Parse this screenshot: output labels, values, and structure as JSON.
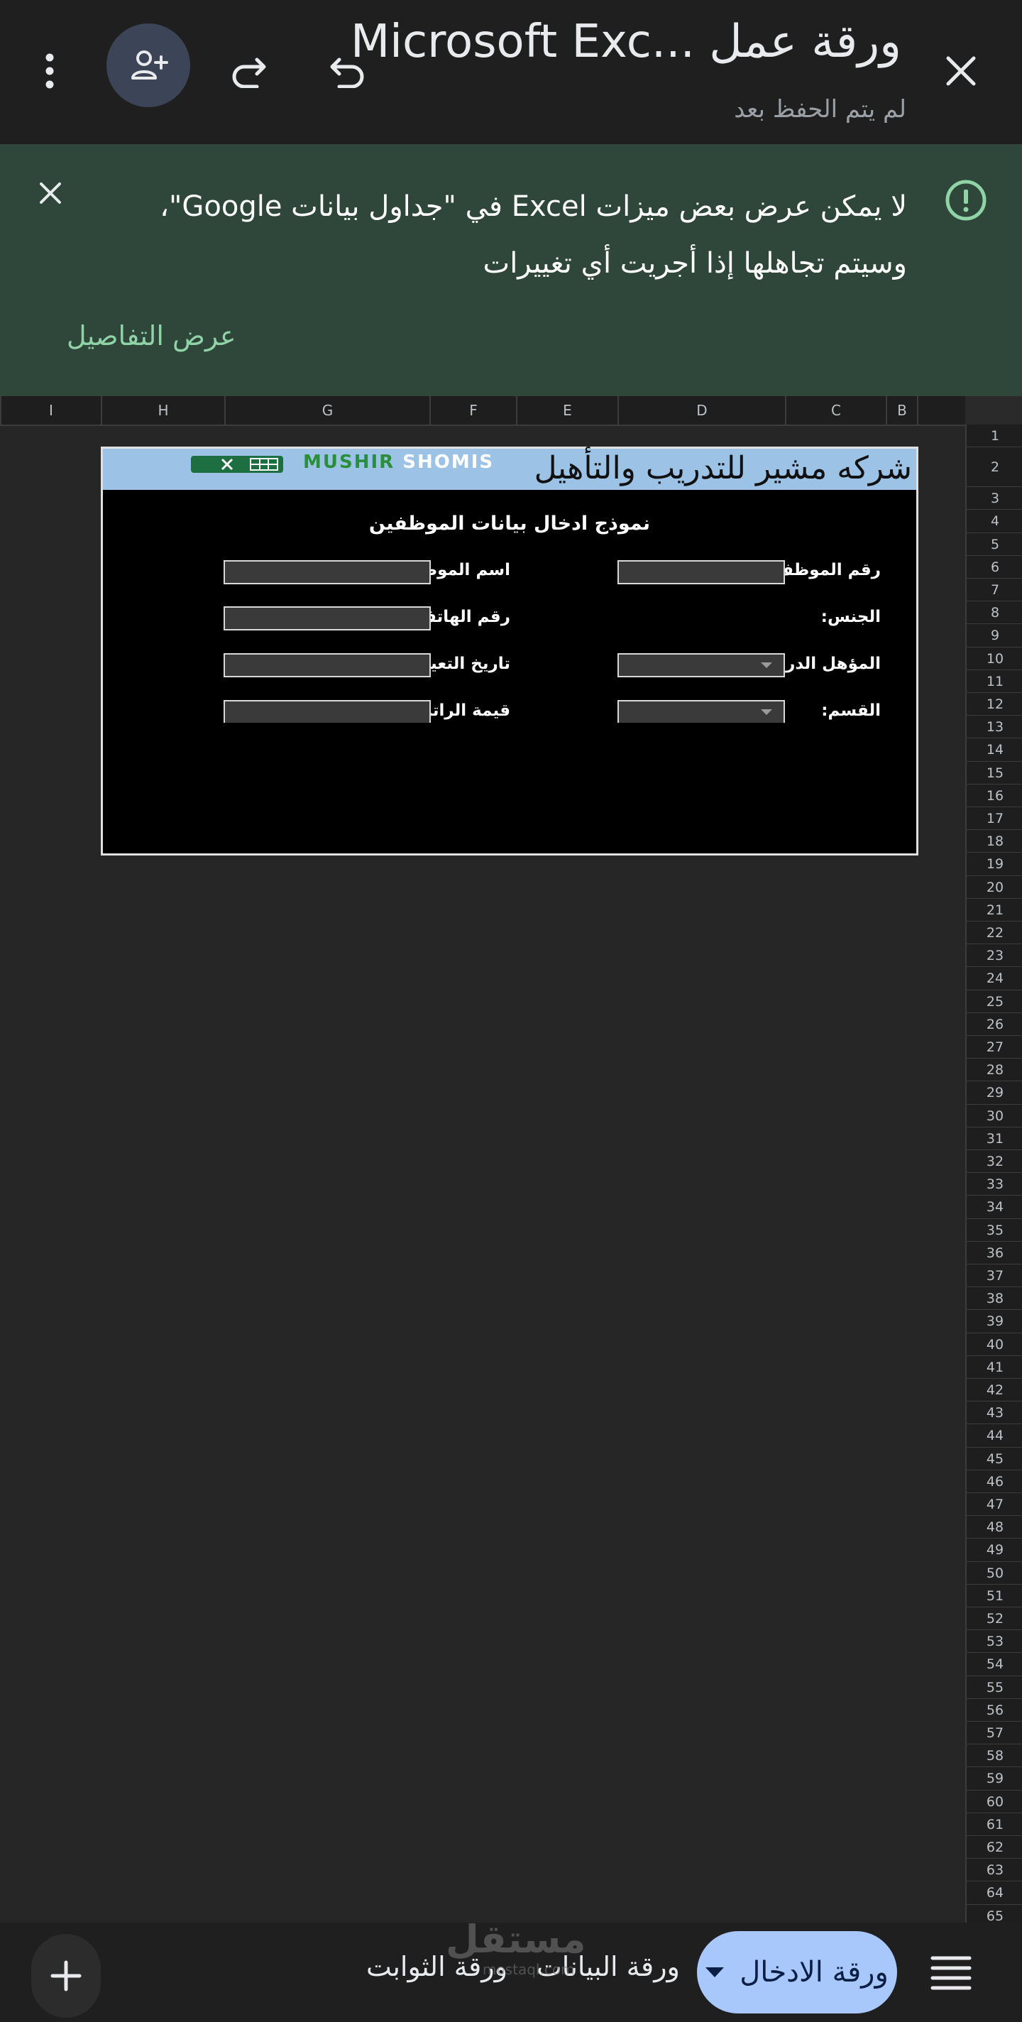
{
  "app_bar": {
    "title": "ورقة عمل ...Microsoft Exc",
    "subtitle": "لم يتم الحفظ بعد",
    "icons": [
      "close-icon",
      "undo-icon",
      "redo-icon",
      "person-add-icon",
      "more-vert-icon"
    ]
  },
  "banner": {
    "message": "لا يمكن عرض بعض ميزات Excel في \"جداول بيانات Google\"، وسيتم تجاهلها إذا أجريت أي تغييرات",
    "details_label": "عرض التفاصيل",
    "accent_color": "#8fd3a6"
  },
  "grid": {
    "columns": [
      "I",
      "H",
      "G",
      "F",
      "E",
      "D",
      "C",
      "B"
    ],
    "rows": [
      "1",
      "2",
      "3",
      "4",
      "5",
      "6",
      "7",
      "8",
      "9",
      "10",
      "11",
      "12",
      "13",
      "14",
      "15",
      "16",
      "17",
      "18",
      "19",
      "20",
      "21",
      "22",
      "23",
      "24",
      "25",
      "26",
      "27",
      "28",
      "29",
      "30",
      "31",
      "32",
      "33",
      "34",
      "35",
      "36",
      "37",
      "38",
      "39",
      "40",
      "41",
      "42",
      "43",
      "44",
      "45",
      "46",
      "47",
      "48",
      "49",
      "50",
      "51",
      "52",
      "53",
      "54",
      "55",
      "56",
      "57",
      "58",
      "59",
      "60",
      "61",
      "62",
      "63",
      "64",
      "65"
    ]
  },
  "form": {
    "company_name": "شركه مشير للتدريب والتأهيل",
    "logo_text_green": "MUSHIR",
    "logo_text_white": "SHOMIS",
    "heading": "نموذج ادخال بيانات الموظفين",
    "fields": {
      "employee_number": "رقم الموظف:",
      "employee_name": "اسم الموظف:",
      "gender": "الجنس:",
      "phone": "رقم الهاتف:",
      "qualification": "المؤهل الدراسي",
      "hire_date": "تاريخ التعيين:",
      "department": "القسم:",
      "salary": "قيمة الراتب:"
    }
  },
  "sheet_tabs": {
    "active": "ورقة الادخال",
    "others": [
      "ورقة البيانات",
      "ورقة الثوابت"
    ],
    "active_color": "#a8c7fa"
  },
  "watermark": {
    "text": "مستقل",
    "sub": "mostaql.com"
  }
}
